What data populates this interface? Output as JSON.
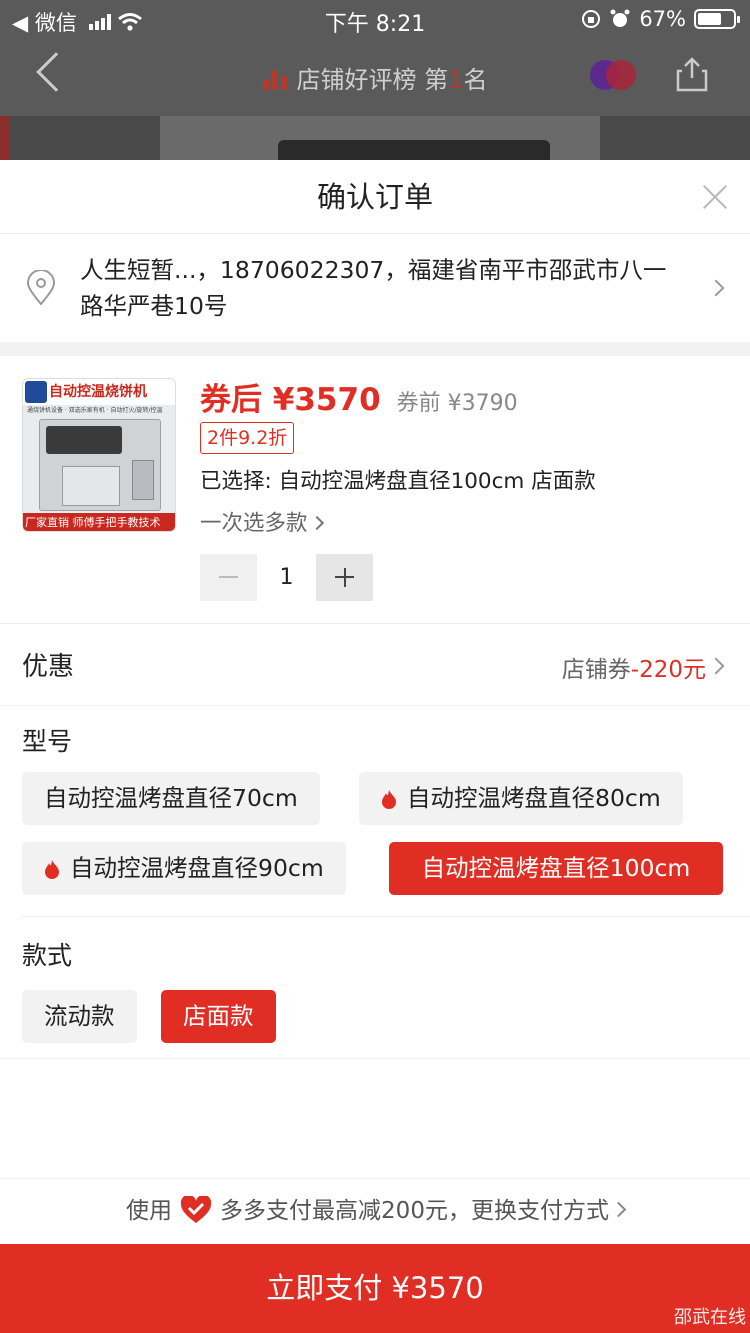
{
  "status_bar": {
    "back_app": "◀ 微信",
    "time": "下午 8:21",
    "battery": "67%",
    "battery_level": 0.67
  },
  "nav": {
    "title_prefix": "店铺好评榜 第",
    "rank": "1",
    "title_suffix": "名"
  },
  "sheet": {
    "title": "确认订单",
    "address": "人生短暂...，18706022307，福建省南平市邵武市八一路华严巷10号"
  },
  "product": {
    "thumb_title": "自动控温烧饼机",
    "thumb_subtitle": "通烧饼机设备 · 双选乐家有机 · 自动打火/旋转/控温",
    "thumb_bottom": "厂家直销  师傅手把手教技术",
    "price_after": "券后 ¥3570",
    "price_before": "券前 ¥3790",
    "discount_tag": "2件9.2折",
    "selected": "已选择: 自动控温烤盘直径100cm 店面款",
    "multi_select": "一次选多款",
    "quantity": "1"
  },
  "promo": {
    "label": "优惠",
    "coupon_label": "店铺券",
    "coupon_value": "-220元"
  },
  "model": {
    "title": "型号",
    "options": [
      {
        "label": "自动控温烤盘直径70cm",
        "hot": false,
        "selected": false
      },
      {
        "label": "自动控温烤盘直径80cm",
        "hot": true,
        "selected": false
      },
      {
        "label": "自动控温烤盘直径90cm",
        "hot": true,
        "selected": false
      },
      {
        "label": "自动控温烤盘直径100cm",
        "hot": false,
        "selected": true
      }
    ]
  },
  "style": {
    "title": "款式",
    "options": [
      {
        "label": "流动款",
        "selected": false
      },
      {
        "label": "店面款",
        "selected": true
      }
    ]
  },
  "pay_hint": {
    "prefix": "使用",
    "text": "多多支付最高减200元，更换支付方式"
  },
  "pay_button": "立即支付 ¥3570",
  "watermark": "邵武在线",
  "colors": {
    "accent": "#e02e24",
    "flame": "#e02e24"
  }
}
